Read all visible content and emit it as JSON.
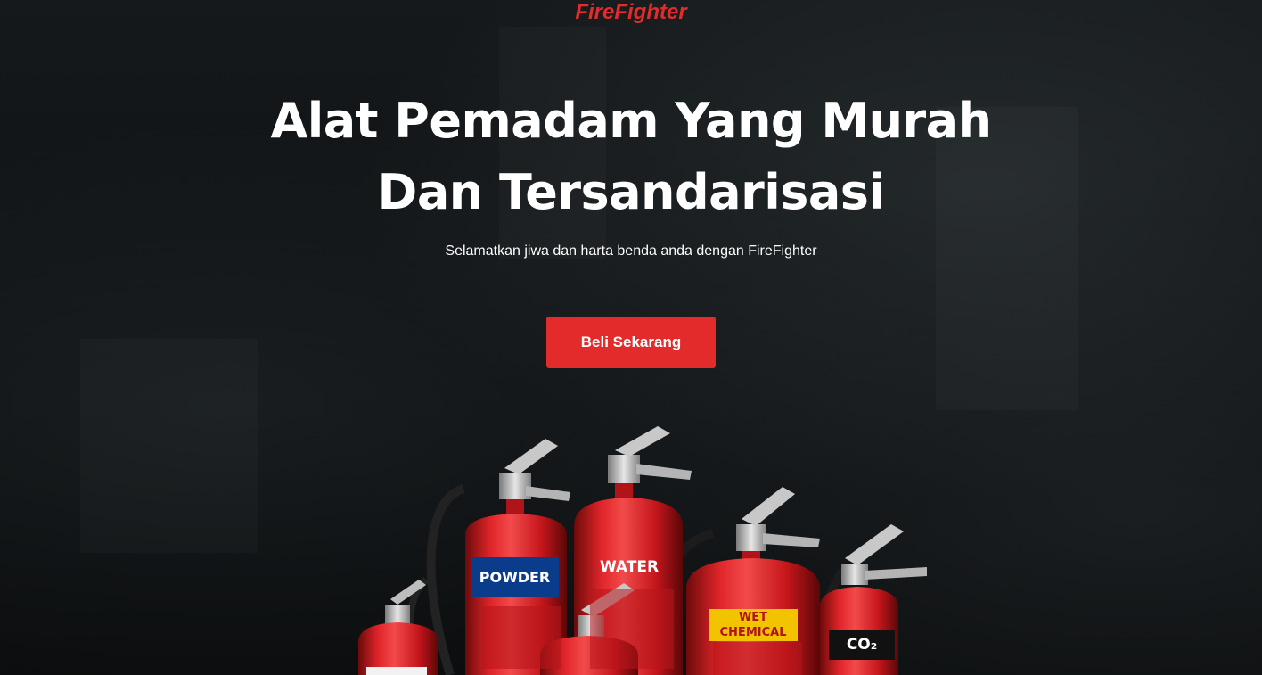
{
  "brand": {
    "name": "FireFighter",
    "color": "#e32b2b"
  },
  "hero": {
    "headline": "Alat Pemadam Yang Murah Dan Tersandarisasi",
    "subtitle": "Selamatkan jiwa dan harta benda anda dengan FireFighter",
    "cta_label": "Beli Sekarang"
  },
  "extinguishers": {
    "powder": "POWDER",
    "water": "WATER",
    "wet_chemical": "WET CHEMICAL",
    "co2": "CO₂"
  },
  "colors": {
    "accent": "#e32b2b",
    "background": "#0d1012",
    "powder_label": "#0b3c8c",
    "wet_label": "#f2c400",
    "co2_label": "#111111"
  }
}
